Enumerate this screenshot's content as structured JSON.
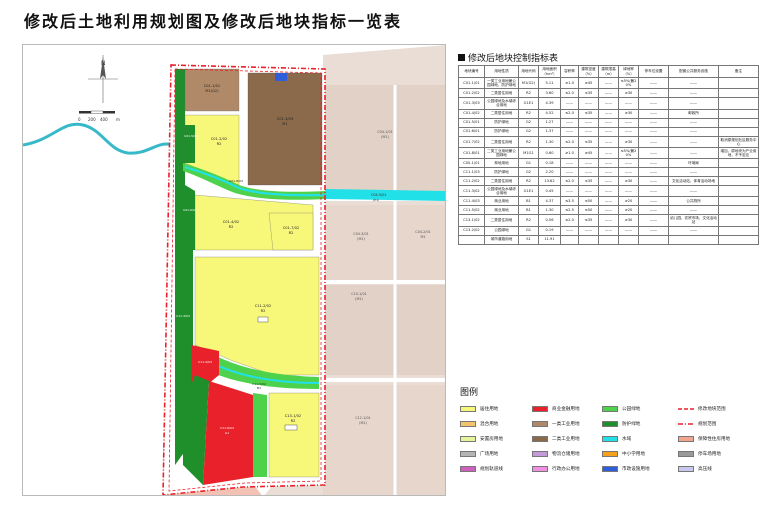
{
  "title": "修改后土地利用规划图及修改后地块指标一览表",
  "table_title": "修改后地块控制指标表",
  "legend_title": "图例",
  "map": {
    "north": "N",
    "scale_labels": [
      "0",
      "200",
      "400",
      "m"
    ],
    "parcels": {
      "c01_1": {
        "code": "C01-1/01",
        "use": "M1(G2)"
      },
      "c01_2": {
        "code": "C01-2/02",
        "use": "R2"
      },
      "c01_3": {
        "code": "C01-3/03",
        "use": "G2"
      },
      "c01_4": {
        "code": "C01-4/02",
        "use": "R2"
      },
      "c01_5": {
        "code": "C01-5/01",
        "use": "M1"
      },
      "c01_6": {
        "code": "C01-6/01",
        "use": "G2"
      },
      "c01_7": {
        "code": "C01-7/02",
        "use": "R2"
      },
      "c01_8": {
        "code": "C01-8/03",
        "use": "G1"
      },
      "c11_2": {
        "code": "C11-2/02",
        "use": "R2"
      },
      "c11_3": {
        "code": "C11-3/03",
        "use": "G1"
      },
      "c11_4": {
        "code": "C11-4/03",
        "use": "G1"
      },
      "c11_5": {
        "code": "C11-5/02",
        "use": "B1"
      },
      "c11_6": {
        "code": "C11-6/03",
        "use": "G1"
      },
      "c13_1": {
        "code": "C13-1/02",
        "use": "R2"
      },
      "c04_1": {
        "code": "C04-1/01",
        "use": "(M1)"
      },
      "c04_2": {
        "code": "C04-2/01",
        "use": "M1"
      },
      "c04_3": {
        "code": "C04-3/01",
        "use": "(M1)"
      },
      "c10_1": {
        "code": "C10-1/01",
        "use": "(M1)"
      },
      "c12_1": {
        "code": "C12-1/01",
        "use": "(M1)"
      }
    },
    "river_label": "C04-5/01",
    "river_sub": "(E1)"
  },
  "table": {
    "headers": [
      "地块编号",
      "用地性质",
      "用地代码",
      "用地面积（hm²）",
      "容积率",
      "建筑密度（%）",
      "建筑限高（m）",
      "绿地率（%）",
      "停车位设置",
      "配套公共服务设施",
      "备注"
    ],
    "rows": [
      [
        "C01-1/01",
        "一类工业用地兼公园绿地、防护绿地",
        "M1(G2)",
        "5.11",
        "≥1.0",
        "≥45",
        "——",
        "≤5%/兼20%",
        "——",
        "——",
        ""
      ],
      [
        "C01-2/02",
        "二类居住用地",
        "R2",
        "3.60",
        "≤2.0",
        "≤35",
        "——",
        "≥30",
        "——",
        "——",
        ""
      ],
      [
        "C01-3/03",
        "公园绿地及水域综合用地",
        "G1E1",
        "4.39",
        "——",
        "——",
        "——",
        "——",
        "——",
        "——",
        ""
      ],
      [
        "C01-4/02",
        "二类居住用地",
        "R2",
        "4.52",
        "≤2.0",
        "≤35",
        "——",
        "≥30",
        "——",
        "邮政所",
        ""
      ],
      [
        "C01-5/01",
        "防护绿地",
        "G2",
        "1.27",
        "——",
        "——",
        "——",
        "——",
        "——",
        "——",
        ""
      ],
      [
        "C01-6/01",
        "防护绿地",
        "G2",
        "1.37",
        "——",
        "——",
        "——",
        "——",
        "——",
        "——",
        ""
      ],
      [
        "C01-7/02",
        "二类居住用地",
        "R2",
        "1.30",
        "≤2.0",
        "≤35",
        "——",
        "≥30",
        "——",
        "——",
        "取消原规划社区服务中心"
      ],
      [
        "C01-8/01",
        "二类工业用地兼公园绿地",
        "M1G1",
        "0.60",
        "≥1.0",
        "≥45",
        "——",
        "≤5%/兼20%",
        "——",
        "——",
        "增加，原地块为产业用地，不予定论"
      ],
      [
        "C05-1/01",
        "林地用地",
        "G1",
        "0.18",
        "——",
        "——",
        "——",
        "——",
        "——",
        "环境局",
        ""
      ],
      [
        "C11-1/03",
        "防护绿地",
        "G2",
        "2.20",
        "——",
        "——",
        "——",
        "——",
        "——",
        "——",
        ""
      ],
      [
        "C11-2/02",
        "二类居住用地",
        "R2",
        "13.62",
        "≤2.0",
        "≤35",
        "——",
        "≥30",
        "——",
        "文化活动站、体育活动场地",
        ""
      ],
      [
        "C11-3/02",
        "公园绿地及水域综合用地",
        "G1E1",
        "0.45",
        "——",
        "——",
        "——",
        "——",
        "——",
        "——",
        ""
      ],
      [
        "C11-4/03",
        "商业用地",
        "B1",
        "4.37",
        "≤3.5",
        "≤50",
        "——",
        "≥20",
        "——",
        "公共厕所",
        ""
      ],
      [
        "C11-5/02",
        "商业用地",
        "B1",
        "1.30",
        "≤2.5",
        "≤50",
        "——",
        "≥20",
        "——",
        "——",
        ""
      ],
      [
        "C13-1/02",
        "二类居住用地",
        "R2",
        "0.56",
        "≤2.0",
        "≤35",
        "——",
        "≥30",
        "——",
        "幼儿园、农贸市场、文化活动站",
        ""
      ],
      [
        "C13-2/02",
        "公园绿地",
        "G1",
        "0.19",
        "——",
        "——",
        "——",
        "——",
        "——",
        "——",
        ""
      ],
      [
        "",
        "城市道路用地",
        "S1",
        "11.91",
        "",
        "",
        "",
        "",
        "",
        "",
        ""
      ]
    ]
  },
  "legend": [
    {
      "label": "居住用地",
      "color": "#f7f77a",
      "kind": "fill"
    },
    {
      "label": "商业金融用地",
      "color": "#e8212b",
      "kind": "fill"
    },
    {
      "label": "公园绿地",
      "color": "#4fd24b",
      "kind": "fill"
    },
    {
      "label": "修改地块范围",
      "color": "#e8212b",
      "kind": "dash"
    },
    {
      "label": "混合用地",
      "color": "#f4c36a",
      "kind": "fill"
    },
    {
      "label": "一类工业用地",
      "color": "#b08a68",
      "kind": "fill"
    },
    {
      "label": "防护绿地",
      "color": "#1f8f2c",
      "kind": "fill"
    },
    {
      "label": "规划范围",
      "color": "#e8212b",
      "kind": "dashdot"
    },
    {
      "label": "安置房用地",
      "color": "#e7f59a",
      "kind": "fill"
    },
    {
      "label": "二类工业用地",
      "color": "#8a6a4a",
      "kind": "fill"
    },
    {
      "label": "水域",
      "color": "#22e0e8",
      "kind": "fill"
    },
    {
      "label": "保障性住房用地",
      "color": "#f2a48c",
      "kind": "fill"
    },
    {
      "label": "广场用地",
      "color": "#b5b5b5",
      "kind": "fill"
    },
    {
      "label": "物流仓储用地",
      "color": "#c59ad8",
      "kind": "fill"
    },
    {
      "label": "中小学用地",
      "color": "#f5a11c",
      "kind": "fill"
    },
    {
      "label": "停车场用地",
      "color": "#9a9a9a",
      "kind": "fill"
    },
    {
      "label": "规划轨道线",
      "color": "#d060c0",
      "kind": "fill"
    },
    {
      "label": "行政办公用地",
      "color": "#f190e0",
      "kind": "fill"
    },
    {
      "label": "市政设施用地",
      "color": "#2f5fd8",
      "kind": "fill"
    },
    {
      "label": "高压线",
      "color": "#c8c8ee",
      "kind": "fill"
    }
  ],
  "colors": {
    "residential": "#f7f77a",
    "commercial": "#e8212b",
    "park": "#4fd24b",
    "protective": "#1f8f2c",
    "industrial1": "#b08a68",
    "industrial2": "#8a6a4a",
    "water": "#22e0e8",
    "outside_land": "#e9ddd5",
    "boundary": "#e8212b"
  }
}
